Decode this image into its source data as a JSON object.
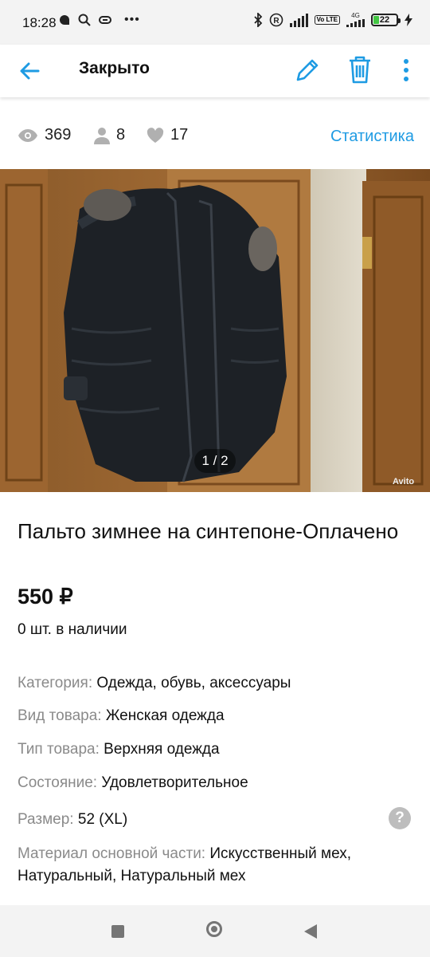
{
  "status_bar": {
    "time": "18:28",
    "network_badge": "Vo LTE",
    "network_type": "4G",
    "battery": "22",
    "icons": [
      "chat-icon",
      "search-icon",
      "link-icon",
      "more-dots-icon",
      "bluetooth-icon",
      "registered-icon",
      "signal-icon",
      "charging-icon"
    ]
  },
  "app_bar": {
    "title": "Закрыто",
    "accent_color": "#1e9be3"
  },
  "stats": {
    "views": "369",
    "contacts": "8",
    "favorites": "17",
    "link": "Статистика"
  },
  "gallery": {
    "counter": "1 / 2",
    "watermark": "Avito"
  },
  "listing": {
    "title": "Пальто зимнее на синтепоне-Оплачено",
    "price": "550 ₽",
    "stock": "0 шт. в наличии"
  },
  "params": [
    {
      "label": "Категория:",
      "value": "Одежда, обувь, аксессуары"
    },
    {
      "label": "Вид товара:",
      "value": "Женская одежда"
    },
    {
      "label": "Тип товара:",
      "value": "Верхняя одежда"
    },
    {
      "label": "Состояние:",
      "value": "Удовлетворительное"
    },
    {
      "label": "Размер:",
      "value": "52 (XL)"
    },
    {
      "label": "Материал основной части:",
      "value": "Искусственный мех, Натуральный, Натуральный мех"
    }
  ],
  "help_icon": "?"
}
